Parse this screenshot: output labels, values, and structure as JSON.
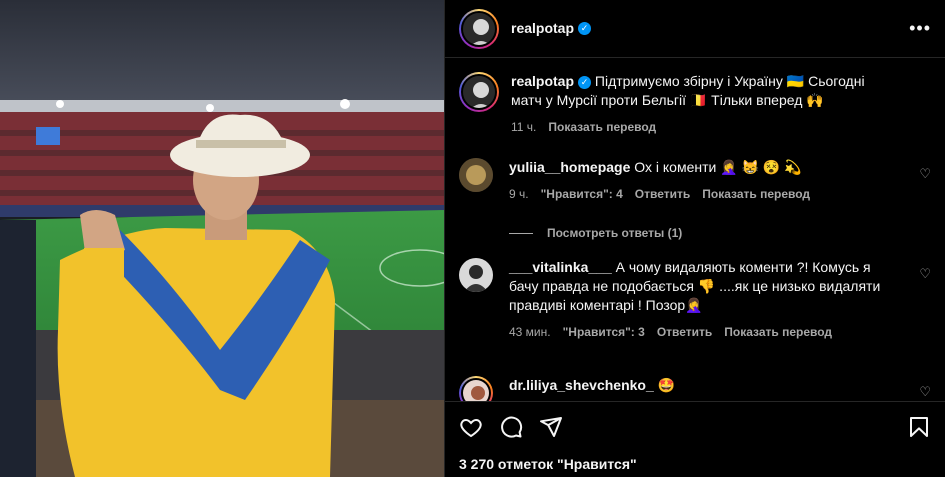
{
  "post": {
    "author": "realpotap",
    "caption": "Підтримуємо збірну і Україну 🇺🇦 Сьогодні матч у Мурсії проти Бельгії 🇧🇪 Тільки вперед 🙌",
    "time": "11 ч.",
    "translate": "Показать перевод",
    "likes": "3 270 отметок \"Нравится\""
  },
  "comments": [
    {
      "user": "yuliia__homepage",
      "text": "Ох і коменти 🤦‍♀️ 😸 😵 💫",
      "time": "9 ч.",
      "likes": "\"Нравится\": 4",
      "reply": "Ответить",
      "translate": "Показать перевод"
    },
    {
      "user": "___vitalinka___",
      "text": "А чому видаляють коменти ?! Комусь я бачу правда не подобається 👎 ....як це низько видаляти правдиві коментарі ! Позор🤦‍♀️",
      "time": "43 мин.",
      "likes": "\"Нравится\": 3",
      "reply": "Ответить",
      "translate": "Показать перевод"
    },
    {
      "user": "dr.liliya_shevchenko_",
      "text": "🤩"
    }
  ],
  "view_replies": "Посмотреть ответы (1)",
  "colors": {
    "accent": "#0095f6",
    "muted": "#a8a8a8",
    "flag_blue": "#2d5fb3",
    "flag_yellow": "#f2c22b",
    "pitch": "#2f8f3a"
  },
  "icons": [
    "heart-icon",
    "comment-icon",
    "share-icon",
    "bookmark-icon",
    "more-icon",
    "verified-icon"
  ]
}
